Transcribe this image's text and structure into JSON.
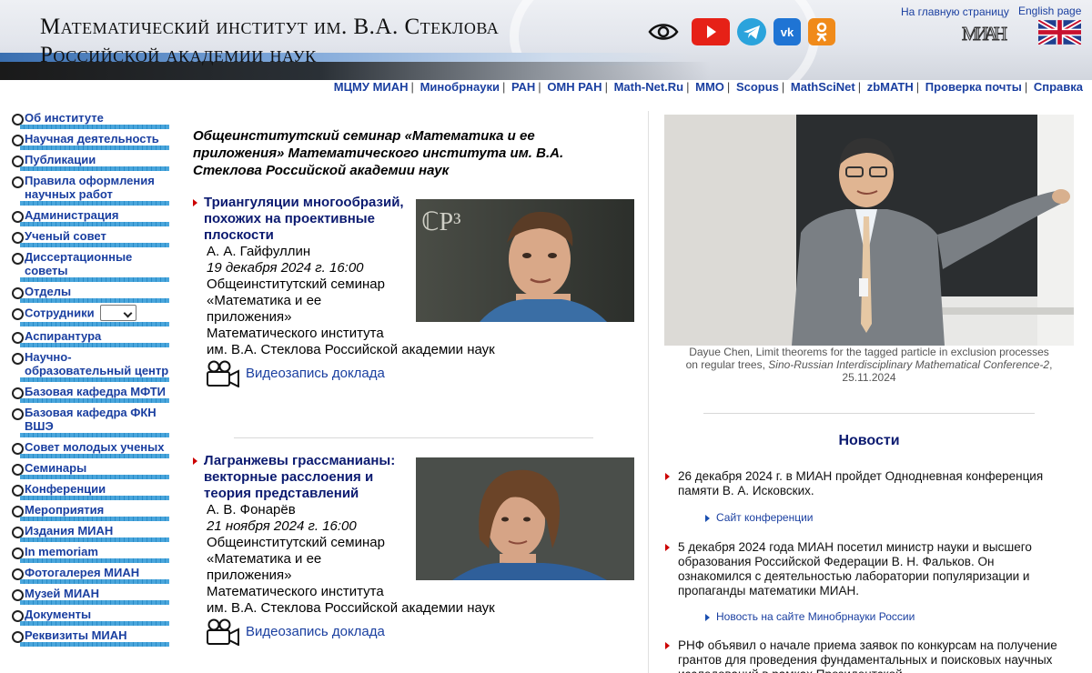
{
  "header": {
    "title_line1": "Математический институт им. В.А. Стеклова",
    "title_line2": "Российской академии наук",
    "home_link": "На главную страницу",
    "english_link": "English page",
    "logo_text": "МИАН"
  },
  "toplinks": [
    "МЦМУ МИАН",
    "Минобрнауки",
    "РАН",
    "ОМН РАН",
    "Math-Net.Ru",
    "ММО",
    "Scopus",
    "MathSciNet",
    "zbMATH",
    "Проверка почты",
    "Справка"
  ],
  "menu": [
    "Об институте",
    "Научная деятельность",
    "Публикации",
    "Правила оформления научных работ",
    "Администрация",
    "Ученый совет",
    "Диссертационные советы",
    "Отделы",
    "Сотрудники",
    "Аспирантура",
    "Научно-образовательный центр",
    "Базовая кафедра МФТИ",
    "Базовая кафедра ФКН ВШЭ",
    "Совет молодых ученых",
    "Семинары",
    "Конференции",
    "Мероприятия",
    "Издания МИАН",
    "In memoriam",
    "Фотогалерея МИАН",
    "Музей МИАН",
    "Документы",
    "Реквизиты МИАН"
  ],
  "seminar_heading": "Общеинститутский семинар «Математика и ее приложения» Математического института им. В.А. Стеклова Российской академии наук",
  "talks": [
    {
      "title": "Триангуляции многообразий, похожих на проективные плоскости",
      "speaker": "А. А. Гайфуллин",
      "date": "19 декабря 2024 г. 16:00",
      "seminar_line1": "Общеинститутский семинар",
      "seminar_line2": "«Математика и ее",
      "seminar_line3": "приложения»",
      "seminar_line4": "Математического института",
      "seminar_line5": "им. В.А. Стеклова Российской академии наук",
      "video": "Видеозапись доклада",
      "board_text": "ℂP³"
    },
    {
      "title": "Лагранжевы грассманианы: векторные расслоения и теория представлений",
      "speaker": "А. В. Фонарёв",
      "date": "21 ноября 2024 г. 16:00",
      "seminar_line1": "Общеинститутский семинар",
      "seminar_line2": "«Математика и ее",
      "seminar_line3": "приложения»",
      "seminar_line4": "Математического института",
      "seminar_line5": "им. В.А. Стеклова Российской академии наук",
      "video": "Видеозапись доклада"
    }
  ],
  "photo_caption": {
    "line1": "Dayue Chen, Limit theorems for the tagged particle in exclusion processes",
    "line2_plain": "on regular trees, ",
    "line2_italic": "Sino-Russian Interdisciplinary Mathematical Conference-2",
    "line2_end": ",",
    "line3": "25.11.2024"
  },
  "news": {
    "title": "Новости",
    "items": [
      {
        "text": "26 декабря 2024 г. в МИАН пройдет Однодневная конференция памяти В. А. Исковских.",
        "link": "Сайт конференции"
      },
      {
        "text": "5 декабря 2024 года МИАН посетил министр науки и высшего образования Российской Федерации В. Н. Фальков. Он ознакомился с деятельностью лаборатории популяризации и пропаганды математики МИАН.",
        "link": "Новость на сайте Минобрнауки России"
      },
      {
        "text": "РНФ объявил о начале приема заявок по конкурсам на получение грантов для проведения фундаментальных и поисковых научных исследований в рамках Президентской"
      }
    ]
  },
  "colors": {
    "link": "#1a3fa0",
    "title_navy": "#0b1a70",
    "arrow_red": "#cc0000",
    "menu_stripe": "#4aa6dc"
  }
}
